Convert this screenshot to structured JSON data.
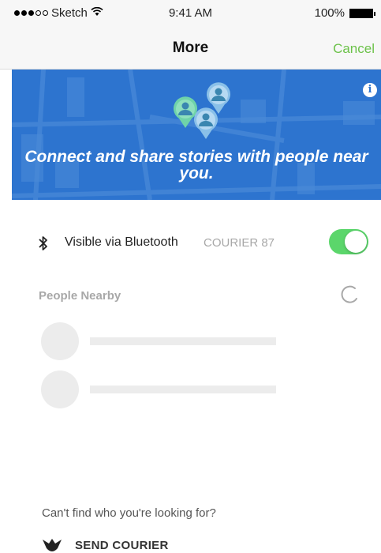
{
  "status_bar": {
    "carrier": "Sketch",
    "time": "9:41 AM",
    "battery": "100%",
    "signal_dots": [
      true,
      true,
      true,
      false,
      false
    ]
  },
  "nav": {
    "title": "More",
    "cancel_label": "Cancel"
  },
  "banner": {
    "text": "Connect and share stories with people near you.",
    "info_icon": "info-icon",
    "background_color": "#2d74cf"
  },
  "bluetooth": {
    "label": "Visible via Bluetooth",
    "device_name": "COURIER 87",
    "toggle_on": true,
    "toggle_color": "#5bd66b"
  },
  "nearby": {
    "title": "People Nearby",
    "placeholder_rows": 2
  },
  "footer": {
    "question": "Can't find who you're looking for?",
    "send_label": "SEND COURIER"
  },
  "colors": {
    "accent": "#6cc24a",
    "muted": "#a8a8a8"
  }
}
